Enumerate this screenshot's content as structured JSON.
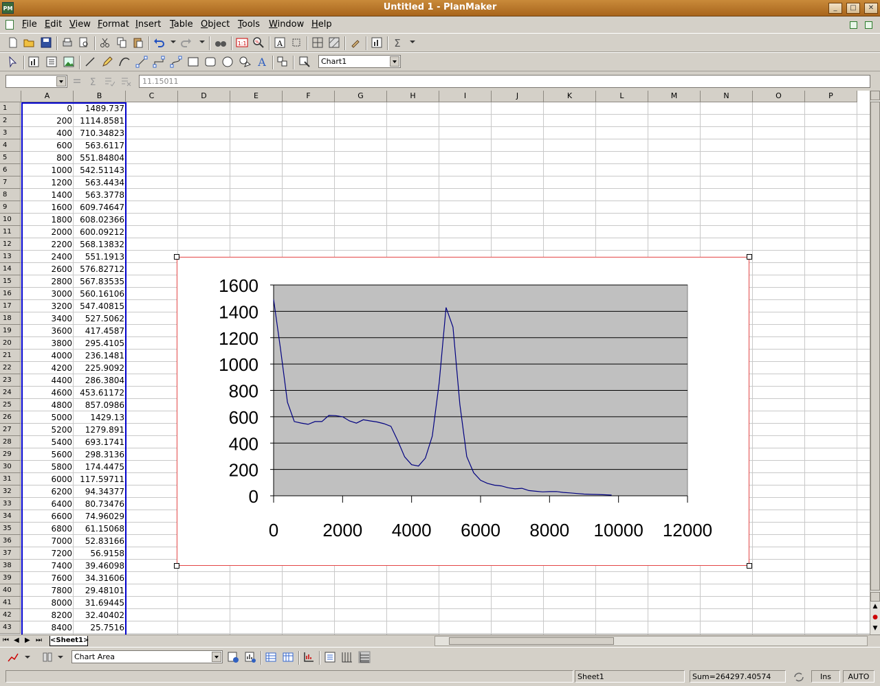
{
  "window": {
    "title": "Untitled 1 - PlanMaker",
    "app_badge": "PM"
  },
  "menu": [
    "File",
    "Edit",
    "View",
    "Format",
    "Insert",
    "Table",
    "Object",
    "Tools",
    "Window",
    "Help"
  ],
  "toolbar2": {
    "chart_selector": "Chart1"
  },
  "edit_bar": {
    "cell_ref": "",
    "formula": "11.15011"
  },
  "columns": [
    "A",
    "B",
    "C",
    "D",
    "E",
    "F",
    "G",
    "H",
    "I",
    "J",
    "K",
    "L",
    "M",
    "N",
    "O",
    "P"
  ],
  "rows": [
    {
      "n": "1",
      "a": "0",
      "b": "1489.737"
    },
    {
      "n": "2",
      "a": "200",
      "b": "1114.8581"
    },
    {
      "n": "3",
      "a": "400",
      "b": "710.34823"
    },
    {
      "n": "4",
      "a": "600",
      "b": "563.6117"
    },
    {
      "n": "5",
      "a": "800",
      "b": "551.84804"
    },
    {
      "n": "6",
      "a": "1000",
      "b": "542.51143"
    },
    {
      "n": "7",
      "a": "1200",
      "b": "563.4434"
    },
    {
      "n": "8",
      "a": "1400",
      "b": "563.3778"
    },
    {
      "n": "9",
      "a": "1600",
      "b": "609.74647"
    },
    {
      "n": "10",
      "a": "1800",
      "b": "608.02366"
    },
    {
      "n": "11",
      "a": "2000",
      "b": "600.09212"
    },
    {
      "n": "12",
      "a": "2200",
      "b": "568.13832"
    },
    {
      "n": "13",
      "a": "2400",
      "b": "551.1913"
    },
    {
      "n": "14",
      "a": "2600",
      "b": "576.82712"
    },
    {
      "n": "15",
      "a": "2800",
      "b": "567.83535"
    },
    {
      "n": "16",
      "a": "3000",
      "b": "560.16106"
    },
    {
      "n": "17",
      "a": "3200",
      "b": "547.40815"
    },
    {
      "n": "18",
      "a": "3400",
      "b": "527.5062"
    },
    {
      "n": "19",
      "a": "3600",
      "b": "417.4587"
    },
    {
      "n": "20",
      "a": "3800",
      "b": "295.4105"
    },
    {
      "n": "21",
      "a": "4000",
      "b": "236.1481"
    },
    {
      "n": "22",
      "a": "4200",
      "b": "225.9092"
    },
    {
      "n": "23",
      "a": "4400",
      "b": "286.3804"
    },
    {
      "n": "24",
      "a": "4600",
      "b": "453.61172"
    },
    {
      "n": "25",
      "a": "4800",
      "b": "857.0986"
    },
    {
      "n": "26",
      "a": "5000",
      "b": "1429.13"
    },
    {
      "n": "27",
      "a": "5200",
      "b": "1279.891"
    },
    {
      "n": "28",
      "a": "5400",
      "b": "693.1741"
    },
    {
      "n": "29",
      "a": "5600",
      "b": "298.3136"
    },
    {
      "n": "30",
      "a": "5800",
      "b": "174.4475"
    },
    {
      "n": "31",
      "a": "6000",
      "b": "117.59711"
    },
    {
      "n": "32",
      "a": "6200",
      "b": "94.34377"
    },
    {
      "n": "33",
      "a": "6400",
      "b": "80.73476"
    },
    {
      "n": "34",
      "a": "6600",
      "b": "74.96029"
    },
    {
      "n": "35",
      "a": "6800",
      "b": "61.15068"
    },
    {
      "n": "36",
      "a": "7000",
      "b": "52.83166"
    },
    {
      "n": "37",
      "a": "7200",
      "b": "56.9158"
    },
    {
      "n": "38",
      "a": "7400",
      "b": "39.46098"
    },
    {
      "n": "39",
      "a": "7600",
      "b": "34.31606"
    },
    {
      "n": "40",
      "a": "7800",
      "b": "29.48101"
    },
    {
      "n": "41",
      "a": "8000",
      "b": "31.69445"
    },
    {
      "n": "42",
      "a": "8200",
      "b": "32.40402"
    },
    {
      "n": "43",
      "a": "8400",
      "b": "25.7516"
    }
  ],
  "chart_data": {
    "type": "line",
    "x": [
      0,
      200,
      400,
      600,
      800,
      1000,
      1200,
      1400,
      1600,
      1800,
      2000,
      2200,
      2400,
      2600,
      2800,
      3000,
      3200,
      3400,
      3600,
      3800,
      4000,
      4200,
      4400,
      4600,
      4800,
      5000,
      5200,
      5400,
      5600,
      5800,
      6000,
      6200,
      6400,
      6600,
      6800,
      7000,
      7200,
      7400,
      7600,
      7800,
      8000,
      8200,
      8400,
      8600,
      8800,
      9000,
      9200,
      9400,
      9600,
      9800
    ],
    "series": [
      {
        "values": [
          1489.737,
          1114.8581,
          710.34823,
          563.6117,
          551.84804,
          542.51143,
          563.4434,
          563.3778,
          609.74647,
          608.02366,
          600.09212,
          568.13832,
          551.1913,
          576.82712,
          567.83535,
          560.16106,
          547.40815,
          527.5062,
          417.4587,
          295.4105,
          236.1481,
          225.9092,
          286.3804,
          453.61172,
          857.0986,
          1429.13,
          1279.891,
          693.1741,
          298.3136,
          174.4475,
          117.59711,
          94.34377,
          80.73476,
          74.96029,
          61.15068,
          52.83166,
          56.9158,
          39.46098,
          34.31606,
          29.48101,
          31.69445,
          32.40402,
          25.7516,
          22,
          17,
          13,
          11,
          10,
          8,
          5
        ]
      }
    ],
    "y_ticks": [
      "0",
      "200",
      "400",
      "600",
      "800",
      "1000",
      "1200",
      "1400",
      "1600"
    ],
    "x_ticks": [
      "0",
      "2000",
      "4000",
      "6000",
      "8000",
      "10000",
      "12000"
    ],
    "xlim": [
      0,
      12000
    ],
    "ylim": [
      0,
      1600
    ],
    "grid": true,
    "plot_background": "#c0c0c0",
    "line_color": "#000080"
  },
  "sheet_tab": "<Sheet1>",
  "object_bar": {
    "object_selector": "Chart Area"
  },
  "status": {
    "sheet": "Sheet1",
    "sum": "Sum=264297.40574",
    "mode": "Ins",
    "calc": "AUTO"
  }
}
